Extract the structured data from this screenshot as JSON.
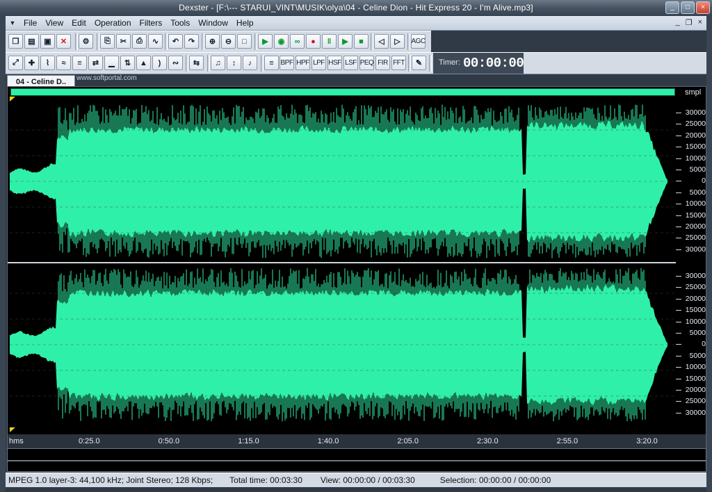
{
  "window": {
    "title": "Dexster - [F:\\---   STARUI_VINT\\MUSIK\\olya\\04 - Celine Dion - Hit Express 20 - I'm Alive.mp3]",
    "controls": [
      "minimize-icon",
      "maximize-icon",
      "close-icon"
    ]
  },
  "menu": {
    "items": [
      "File",
      "View",
      "Edit",
      "Operation",
      "Filters",
      "Tools",
      "Window",
      "Help"
    ],
    "mdi_controls": [
      "_",
      "❐",
      "×"
    ]
  },
  "toolbar1": {
    "buttons": [
      {
        "name": "new-file-icon",
        "glyph": "❒"
      },
      {
        "name": "open-folder-icon",
        "glyph": "▤"
      },
      {
        "name": "save-icon",
        "glyph": "▣"
      },
      {
        "name": "close-file-icon",
        "glyph": "✕"
      },
      {
        "name": "properties-icon",
        "glyph": "⚙"
      },
      {
        "name": "copy-icon",
        "glyph": "⎘"
      },
      {
        "name": "cut-icon",
        "glyph": "✂"
      },
      {
        "name": "paste-icon",
        "glyph": "⎙"
      },
      {
        "name": "mix-paste-icon",
        "glyph": "∿"
      },
      {
        "name": "undo-icon",
        "glyph": "↶"
      },
      {
        "name": "redo-icon",
        "glyph": "↷"
      },
      {
        "name": "zoom-in-icon",
        "glyph": "⊕"
      },
      {
        "name": "zoom-out-icon",
        "glyph": "⊖"
      },
      {
        "name": "zoom-full-icon",
        "glyph": "□"
      },
      {
        "name": "play-icon",
        "glyph": "▶"
      },
      {
        "name": "play-selection-icon",
        "glyph": "◉"
      },
      {
        "name": "loop-icon",
        "glyph": "∞"
      },
      {
        "name": "record-icon",
        "glyph": "●"
      },
      {
        "name": "pause-icon",
        "glyph": "‖"
      },
      {
        "name": "play-to-end-icon",
        "glyph": "▶"
      },
      {
        "name": "stop-icon",
        "glyph": "■"
      },
      {
        "name": "volume-down-icon",
        "glyph": "◁"
      },
      {
        "name": "volume-up-icon",
        "glyph": "▷"
      },
      {
        "name": "agc-button",
        "glyph": "AGC"
      }
    ]
  },
  "toolbar2": {
    "buttons": [
      {
        "name": "fit-view-icon",
        "glyph": "⤢"
      },
      {
        "name": "center-icon",
        "glyph": "✚"
      },
      {
        "name": "waveform-icon",
        "glyph": "⌇"
      },
      {
        "name": "fade-icon",
        "glyph": "≈"
      },
      {
        "name": "normalize-icon",
        "glyph": "≡"
      },
      {
        "name": "reverse-icon",
        "glyph": "⇄"
      },
      {
        "name": "silence-icon",
        "glyph": "▁"
      },
      {
        "name": "invert-icon",
        "glyph": "⇅"
      },
      {
        "name": "amplify-icon",
        "glyph": "▲"
      },
      {
        "name": "echo-icon",
        "glyph": ")"
      },
      {
        "name": "flanger-icon",
        "glyph": "∾"
      },
      {
        "name": "swap-channels-icon",
        "glyph": "⇆"
      },
      {
        "name": "pitch-icon",
        "glyph": "♫"
      },
      {
        "name": "tempo-icon",
        "glyph": "↕"
      },
      {
        "name": "notes-icon",
        "glyph": "♪"
      },
      {
        "name": "eq-icon",
        "glyph": "≡"
      },
      {
        "name": "bpf-button",
        "glyph": "BPF"
      },
      {
        "name": "hpf-button",
        "glyph": "HPF"
      },
      {
        "name": "lpf-button",
        "glyph": "LPF"
      },
      {
        "name": "hsf-button",
        "glyph": "HSF"
      },
      {
        "name": "lsf-button",
        "glyph": "LSF"
      },
      {
        "name": "peq-button",
        "glyph": "PEQ"
      },
      {
        "name": "fir-button",
        "glyph": "FIR"
      },
      {
        "name": "fft-button",
        "glyph": "FFT"
      },
      {
        "name": "edit-filter-icon",
        "glyph": "✎"
      }
    ],
    "timer_label": "Timer:",
    "timer_value": "00:00:00"
  },
  "document": {
    "tab_label": "04 - Celine D..",
    "watermark": "www.softportal.com",
    "unit_label": "smpl",
    "amplitude_labels_top": [
      "30000",
      "25000",
      "20000",
      "15000",
      "10000",
      "5000",
      "0",
      "5000",
      "10000",
      "15000",
      "20000",
      "25000",
      "30000"
    ],
    "amplitude_labels_bottom": [
      "30000",
      "25000",
      "20000",
      "15000",
      "10000",
      "5000",
      "0",
      "5000",
      "10000",
      "15000",
      "20000",
      "25000",
      "30000"
    ],
    "time_unit": "hms",
    "time_labels": [
      "0:25.0",
      "0:50.0",
      "1:15.0",
      "1:40.0",
      "2:05.0",
      "2:30.0",
      "2:55.0",
      "3:20.0"
    ],
    "wave_color": "#2ff0a8"
  },
  "status": {
    "format": "MPEG 1.0 layer-3: 44,100 kHz; Joint Stereo; 128 Kbps;",
    "total_time": "Total time: 00:03:30",
    "view": "View: 00:00:00 / 00:03:30",
    "selection": "Selection: 00:00:00 / 00:00:00"
  }
}
